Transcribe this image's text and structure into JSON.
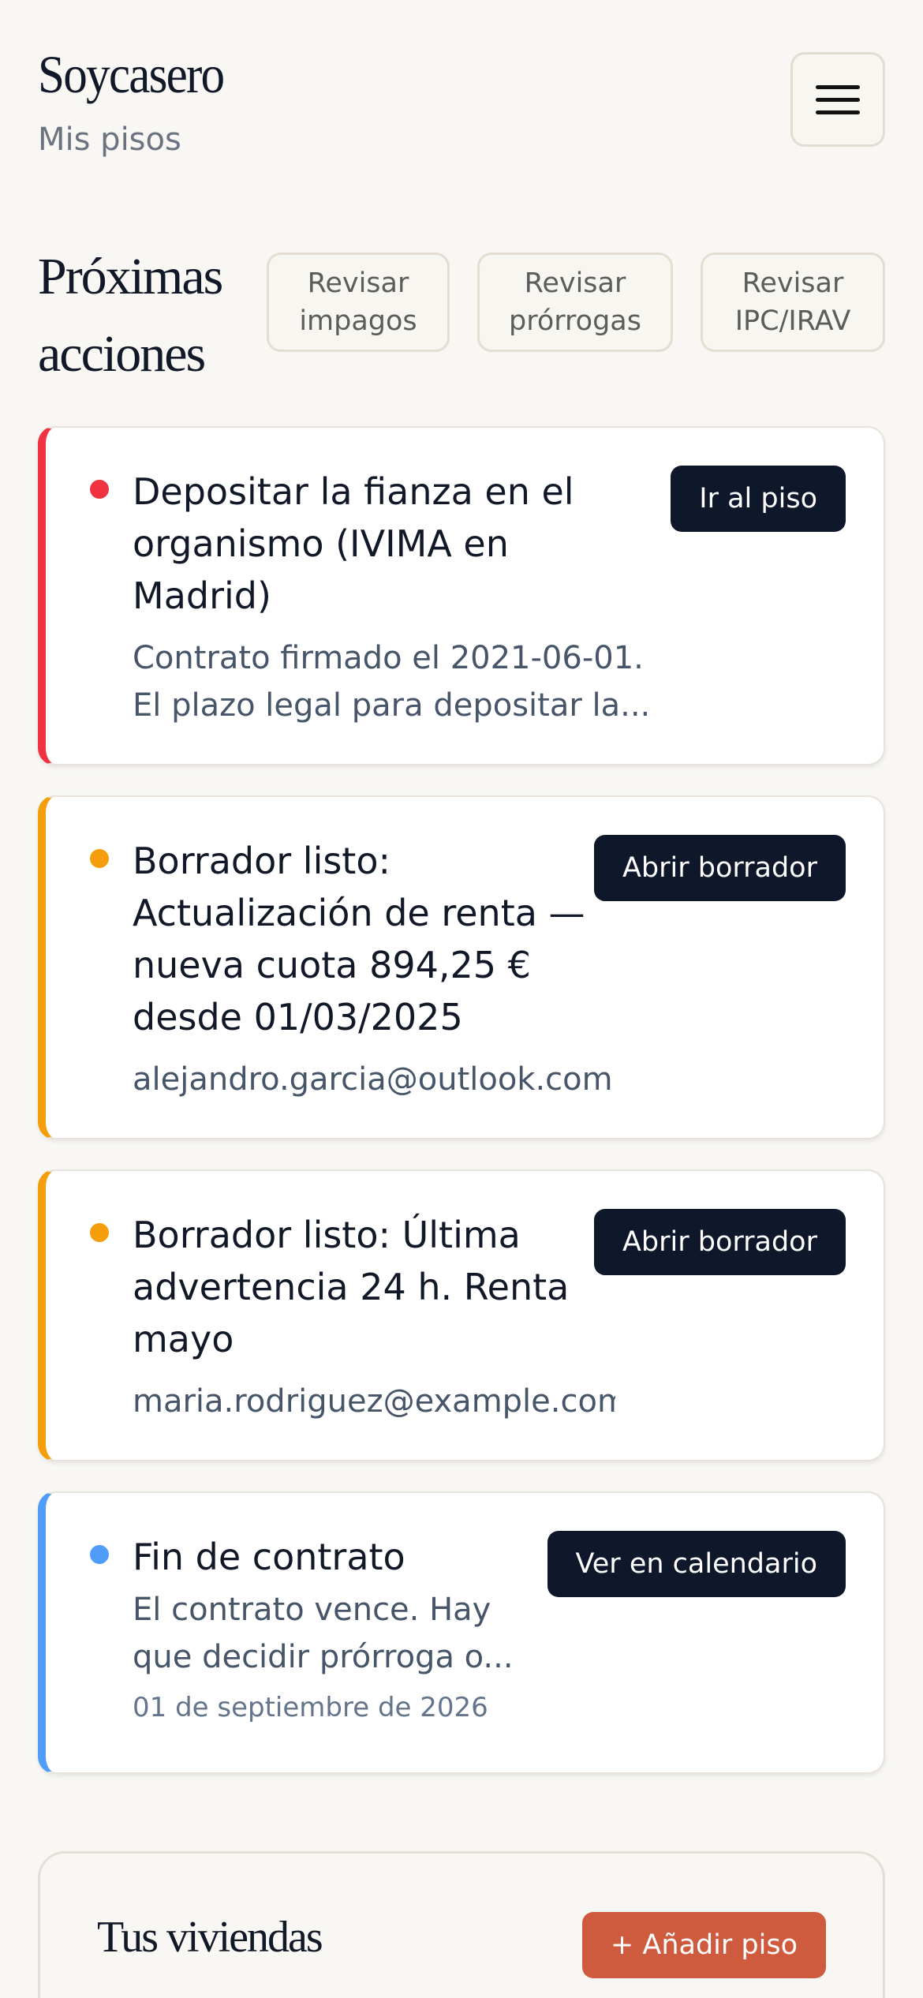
{
  "header": {
    "brand": "Soycasero",
    "subtitle": "Mis pisos"
  },
  "actions_section": {
    "title_line1": "Próximas",
    "title_line2": "acciones",
    "filters": [
      {
        "line1": "Revisar",
        "line2": "impagos"
      },
      {
        "line1": "Revisar",
        "line2": "prórrogas"
      },
      {
        "line1": "Revisar",
        "line2": "IPC/IRAV"
      }
    ]
  },
  "cards": [
    {
      "priority_color": "#ef3340",
      "title": "Depositar la fianza en el organismo (IVIMA en Madrid)",
      "desc_line1": "Contrato firmado el 2021-06-01.",
      "desc_line2": "El plazo legal para depositar la...",
      "button": "Ir al piso"
    },
    {
      "priority_color": "#f59e0b",
      "title": "Borrador listo: Actualización de renta — nueva cuota 894,25 € desde 01/03/2025",
      "desc_line1": "alejandro.garcia@outlook.com",
      "button": "Abrir borrador"
    },
    {
      "priority_color": "#f59e0b",
      "title": "Borrador listo: Última advertencia 24 h. Renta mayo",
      "desc_line1": "maria.rodriguez@example.com",
      "button": "Abrir borrador"
    },
    {
      "priority_color": "#4f9cf9",
      "title": "Fin de contrato",
      "desc_line1": "El contrato vence. Hay",
      "desc_line2": "que decidir prórroga o...",
      "date": "01 de septiembre de 2026",
      "button": "Ver en calendario"
    }
  ],
  "homes": {
    "title": "Tus viviendas",
    "add_button": "+ Añadir piso"
  },
  "colors": {
    "background": "#f8f7f4",
    "dark_button": "#0f172a",
    "add_button": "#cf5b3f",
    "urgent": "#ef3340",
    "warning": "#f59e0b",
    "info": "#4f9cf9"
  }
}
